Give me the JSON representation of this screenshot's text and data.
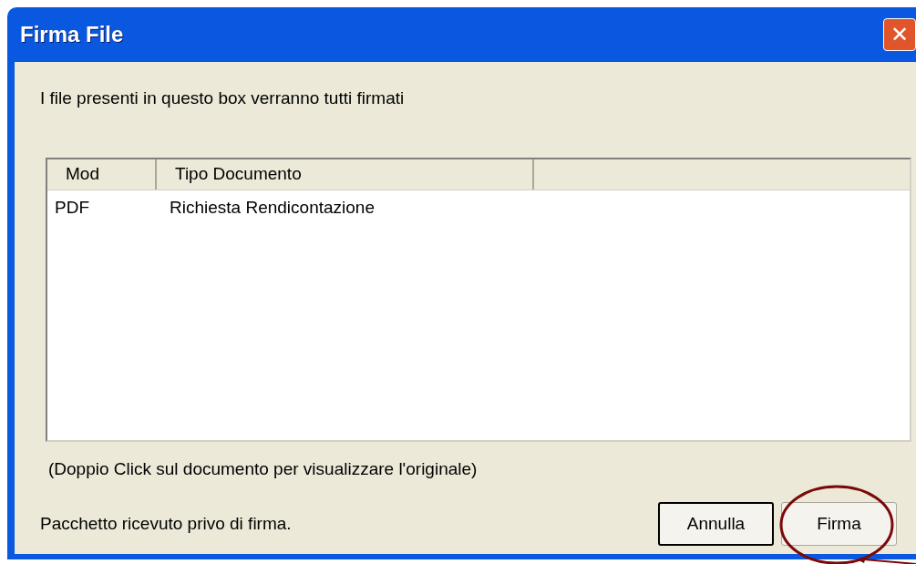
{
  "window": {
    "title": "Firma File",
    "close": "✕"
  },
  "message": "I file presenti in questo box verranno tutti firmati",
  "table": {
    "columns": [
      "Mod",
      "Tipo Documento"
    ],
    "rows": [
      {
        "cells": [
          "PDF",
          "Richiesta Rendicontazione"
        ],
        "selected": false
      }
    ]
  },
  "hint": "(Doppio Click sul documento per visualizzare l'originale)",
  "status": "Pacchetto ricevuto privo di firma.",
  "buttons": [
    {
      "label": "Annulla",
      "default": true,
      "highlighted": false
    },
    {
      "label": "Firma",
      "default": false,
      "highlighted": true
    }
  ]
}
